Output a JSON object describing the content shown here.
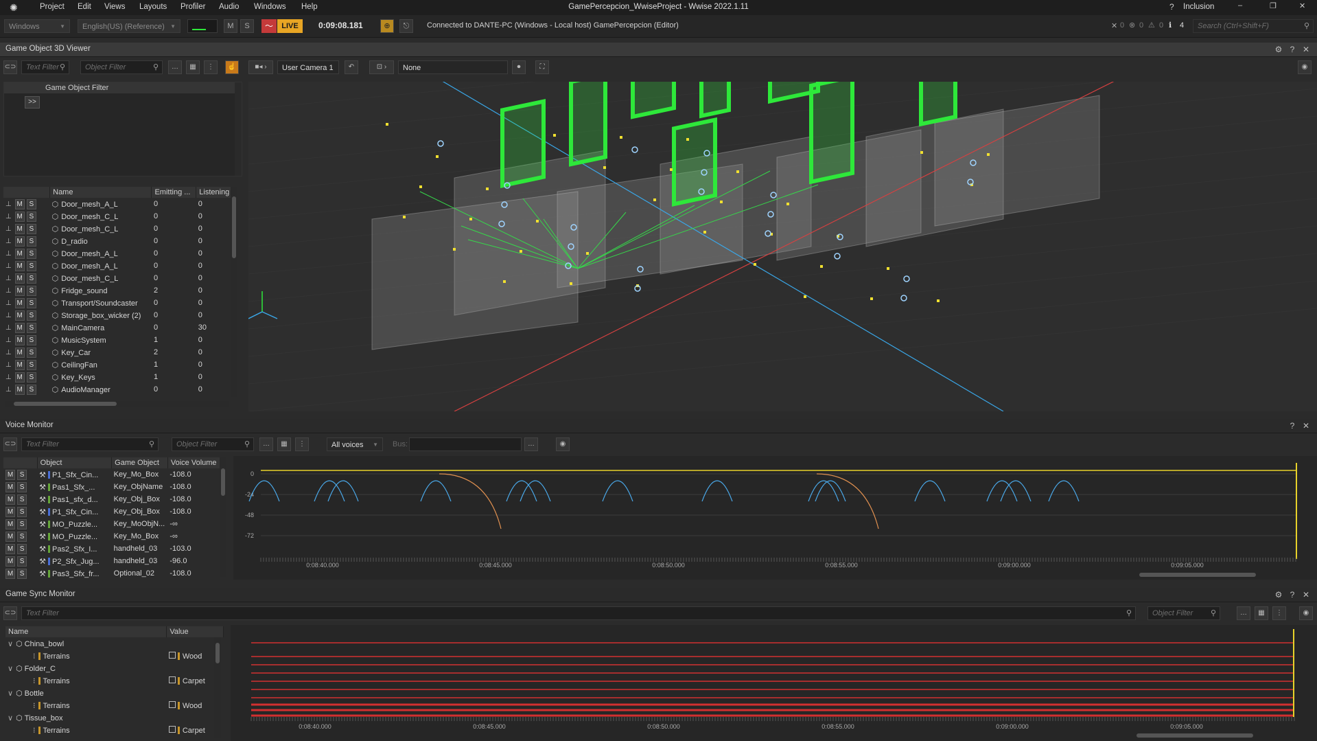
{
  "titlebar": {
    "menu": [
      "Project",
      "Edit",
      "Views",
      "Layouts",
      "Profiler",
      "Audio",
      "Windows",
      "Help"
    ],
    "title": "GamePercepcion_WwiseProject - Wwise 2022.1.11",
    "layout": "Inclusion"
  },
  "toolbar": {
    "platform": "Windows",
    "language": "English(US) (Reference)",
    "mute": "M",
    "solo": "S",
    "live": "LIVE",
    "time": "0:09:08.181",
    "connection": "Connected to DANTE-PC (Windows - Local host) GamePercepcion (Editor)",
    "status_counts": [
      "0",
      "0",
      "0",
      "4"
    ],
    "search_placeholder": "Search (Ctrl+Shift+F)"
  },
  "viewer": {
    "title": "Game Object 3D Viewer",
    "text_filter": "Text Filter",
    "object_filter": "Object Filter",
    "camera": "User Camera 1",
    "listener": "None",
    "filter_header": "Game Object Filter",
    "expand": ">>",
    "columns": [
      "Name",
      "Emitting ...",
      "Listening"
    ],
    "rows": [
      {
        "name": "Door_mesh_A_L",
        "emit": "0",
        "listen": "0"
      },
      {
        "name": "Door_mesh_C_L",
        "emit": "0",
        "listen": "0"
      },
      {
        "name": "Door_mesh_C_L",
        "emit": "0",
        "listen": "0"
      },
      {
        "name": "D_radio",
        "emit": "0",
        "listen": "0"
      },
      {
        "name": "Door_mesh_A_L",
        "emit": "0",
        "listen": "0"
      },
      {
        "name": "Door_mesh_A_L",
        "emit": "0",
        "listen": "0"
      },
      {
        "name": "Door_mesh_C_L",
        "emit": "0",
        "listen": "0"
      },
      {
        "name": "Fridge_sound",
        "emit": "2",
        "listen": "0"
      },
      {
        "name": "Transport/Soundcaster",
        "emit": "0",
        "listen": "0"
      },
      {
        "name": "Storage_box_wicker (2)",
        "emit": "0",
        "listen": "0"
      },
      {
        "name": "MainCamera",
        "emit": "0",
        "listen": "30"
      },
      {
        "name": "MusicSystem",
        "emit": "1",
        "listen": "0"
      },
      {
        "name": "Key_Car",
        "emit": "2",
        "listen": "0"
      },
      {
        "name": "CeilingFan",
        "emit": "1",
        "listen": "0"
      },
      {
        "name": "Key_Keys",
        "emit": "1",
        "listen": "0"
      },
      {
        "name": "AudioManager",
        "emit": "0",
        "listen": "0"
      }
    ]
  },
  "voice_monitor": {
    "title": "Voice Monitor",
    "text_filter": "Text Filter",
    "object_filter": "Object Filter",
    "voices": "All voices",
    "bus_label": "Bus:",
    "columns": [
      "Object",
      "Game Object",
      "Voice Volume"
    ],
    "rows": [
      {
        "object": "P1_Sfx_Cin...",
        "go": "Key_Mo_Box",
        "vol": "-108.0",
        "color": "#4a6fd6"
      },
      {
        "object": "Pas1_Sfx_...",
        "go": "Key_ObjName",
        "vol": "-108.0",
        "color": "#66a63a"
      },
      {
        "object": "Pas1_sfx_d...",
        "go": "Key_Obj_Box",
        "vol": "-108.0",
        "color": "#66a63a"
      },
      {
        "object": "P1_Sfx_Cin...",
        "go": "Key_Obj_Box",
        "vol": "-108.0",
        "color": "#4a6fd6"
      },
      {
        "object": "MO_Puzzle...",
        "go": "Key_MoObjN...",
        "vol": "-∞",
        "color": "#66a63a"
      },
      {
        "object": "MO_Puzzle...",
        "go": "Key_Mo_Box",
        "vol": "-∞",
        "color": "#66a63a"
      },
      {
        "object": "Pas2_Sfx_I...",
        "go": "handheld_03",
        "vol": "-103.0",
        "color": "#66a63a"
      },
      {
        "object": "P2_Sfx_Jug...",
        "go": "handheld_03",
        "vol": "-96.0",
        "color": "#4a6fd6"
      },
      {
        "object": "Pas3_Sfx_fr...",
        "go": "Optional_02",
        "vol": "-108.0",
        "color": "#66a63a"
      }
    ],
    "y_ticks": [
      "0",
      "-24",
      "-48",
      "-72"
    ],
    "time_ticks": [
      "0:08:40.000",
      "0:08:45.000",
      "0:08:50.000",
      "0:08:55.000",
      "0:09:00.000",
      "0:09:05.000"
    ]
  },
  "sync_monitor": {
    "title": "Game Sync Monitor",
    "text_filter": "Text Filter",
    "object_filter": "Object Filter",
    "columns": [
      "Name",
      "Value"
    ],
    "rows": [
      {
        "kind": "obj",
        "name": "China_bowl",
        "value": ""
      },
      {
        "kind": "sw",
        "name": "Terrains",
        "value": "Wood"
      },
      {
        "kind": "obj",
        "name": "Folder_C",
        "value": ""
      },
      {
        "kind": "sw",
        "name": "Terrains",
        "value": "Carpet"
      },
      {
        "kind": "obj",
        "name": "Bottle",
        "value": ""
      },
      {
        "kind": "sw",
        "name": "Terrains",
        "value": "Wood"
      },
      {
        "kind": "obj",
        "name": "Tissue_box",
        "value": ""
      },
      {
        "kind": "sw",
        "name": "Terrains",
        "value": "Carpet"
      }
    ],
    "time_ticks": [
      "0:08:40.000",
      "0:08:45.000",
      "0:08:50.000",
      "0:08:55.000",
      "0:09:00.000",
      "0:09:05.000"
    ]
  },
  "colors": {
    "accent_live": "#e0a020",
    "green": "#2ee83a",
    "blue_axis": "#3aa7e8",
    "red_axis": "#d84040",
    "curve_blue": "#4aa8e8",
    "curve_orange": "#e09050"
  }
}
